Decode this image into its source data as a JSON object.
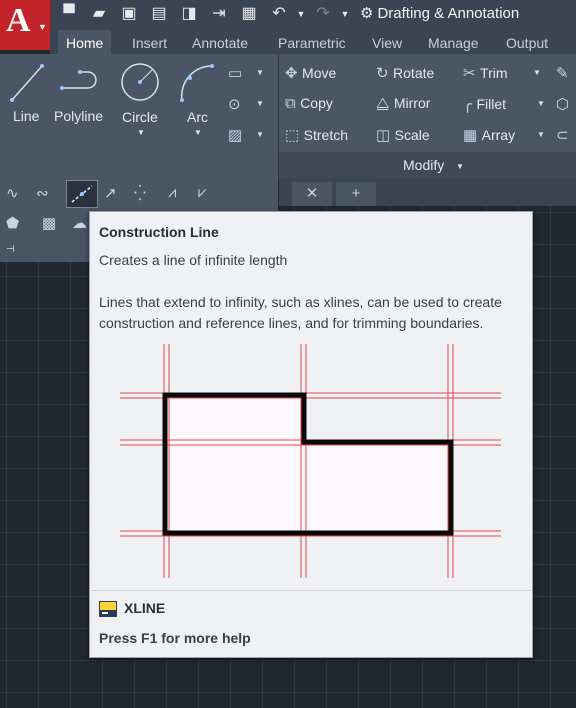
{
  "app": {
    "logo_letter": "A"
  },
  "quick_access": {
    "icons": [
      "new-icon",
      "open-icon",
      "save-icon",
      "save-as-icon",
      "open-web-icon",
      "save-web-icon",
      "plot-icon",
      "undo-icon",
      "redo-icon"
    ],
    "workspace": "Drafting & Annotation"
  },
  "tabs": [
    "Home",
    "Insert",
    "Annotate",
    "Parametric",
    "View",
    "Manage",
    "Output"
  ],
  "active_tab": "Home",
  "draw_panel": {
    "tools": [
      {
        "label": "Line"
      },
      {
        "label": "Polyline"
      },
      {
        "label": "Circle"
      },
      {
        "label": "Arc"
      }
    ]
  },
  "modify_panel": {
    "title": "Modify",
    "rows": [
      [
        "Move",
        "Rotate",
        "Trim"
      ],
      [
        "Copy",
        "Mirror",
        "Fillet"
      ],
      [
        "Stretch",
        "Scale",
        "Array"
      ]
    ]
  },
  "tooltip": {
    "title": "Construction Line",
    "short": "Creates a line of infinite length",
    "long": "Lines that extend to infinity, such as xlines, can be used to create construction and reference lines, and for trimming boundaries.",
    "command": "XLINE",
    "help": "Press F1 for more help"
  },
  "colors": {
    "accent_red": "#c4252b",
    "ribbon_bg": "#4a5566",
    "canvas_bg": "#212830",
    "xline_red": "#e8454a"
  }
}
